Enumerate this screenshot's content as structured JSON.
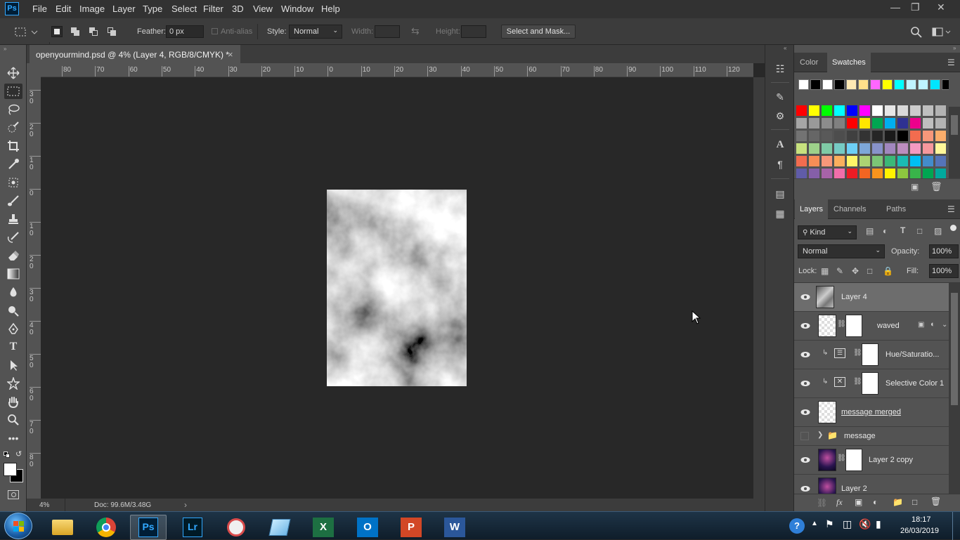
{
  "app": {
    "logo": "Ps"
  },
  "menu": [
    "File",
    "Edit",
    "Image",
    "Layer",
    "Type",
    "Select",
    "Filter",
    "3D",
    "View",
    "Window",
    "Help"
  ],
  "options": {
    "feather_label": "Feather:",
    "feather_value": "0 px",
    "antialias_label": "Anti-alias",
    "style_label": "Style:",
    "style_value": "Normal",
    "width_label": "Width:",
    "height_label": "Height:",
    "select_mask": "Select and Mask..."
  },
  "document": {
    "tab_title": "openyourmind.psd @ 4% (Layer 4, RGB/8/CMYK) *",
    "close": "×",
    "zoom": "4%",
    "doc_size": "Doc: 99.6M/3.48G"
  },
  "ruler": {
    "h_labels": [
      "80",
      "70",
      "60",
      "50",
      "40",
      "30",
      "20",
      "10",
      "0",
      "10",
      "20",
      "30",
      "40",
      "50",
      "60",
      "70",
      "80",
      "90",
      "100",
      "110",
      "120"
    ],
    "v_labels": [
      "3 0",
      "2 0",
      "1 0",
      "0",
      "1 0",
      "2 0",
      "3 0",
      "4 0",
      "5 0",
      "6 0",
      "7 0",
      "8 0"
    ]
  },
  "swatches_panel": {
    "tabs": [
      "Color",
      "Swatches"
    ],
    "active_tab": "Swatches",
    "rows": [
      [
        "#ffffff",
        "#000000",
        "#ffffff",
        "#000000",
        "#fde9b4",
        "#ffe08a",
        "#ff66ff",
        "#ffff00",
        "#00ffff",
        "#bff4ff",
        "#bff4ff",
        "#00e5ff",
        "#000000"
      ],
      [
        "#ff0000",
        "#ffff00",
        "#00ff00",
        "#00ffff",
        "#0000ff",
        "#ff00ff",
        "#ffffff",
        "#e6e6e6",
        "#d9d9d9",
        "#cccccc",
        "#bfbfbf",
        "#b3b3b3"
      ],
      [
        "#a6a6a6",
        "#999999",
        "#8c8c8c",
        "#808080",
        "#ff0000",
        "#ffe600",
        "#00a651",
        "#00aeef",
        "#2e3192",
        "#ec008c",
        "#bfbfbf",
        "#b3b3b3"
      ],
      [
        "#737373",
        "#666666",
        "#595959",
        "#4d4d4d",
        "#404040",
        "#333333",
        "#262626",
        "#1a1a1a",
        "#000000",
        "#f26c4f",
        "#f7977a",
        "#fbad6b"
      ],
      [
        "#c7e17e",
        "#9dd18a",
        "#7fcaa6",
        "#76cbc4",
        "#6dcff6",
        "#7da7d8",
        "#8893ca",
        "#a187be",
        "#bc8dbf",
        "#f49ac1",
        "#f6989d",
        "#fff79a"
      ],
      [
        "#f26c4f",
        "#f68e56",
        "#f7977a",
        "#fbaf5d",
        "#fff568",
        "#acd373",
        "#7cc576",
        "#3bb878",
        "#1abbb4",
        "#00bff3",
        "#438ccb",
        "#5574b9"
      ],
      [
        "#605ca8",
        "#855fa8",
        "#a763a8",
        "#f06eaa",
        "#ed1c24",
        "#f26522",
        "#f7941d",
        "#fff200",
        "#8dc63f",
        "#39b54a",
        "#00a651",
        "#00a99d"
      ]
    ]
  },
  "layers_panel": {
    "tabs": [
      "Layers",
      "Channels",
      "Paths"
    ],
    "active_tab": "Layers",
    "kind": "Kind",
    "blend_mode": "Normal",
    "opacity_label": "Opacity:",
    "opacity_value": "100%",
    "lock_label": "Lock:",
    "fill_label": "Fill:",
    "fill_value": "100%",
    "layers": [
      {
        "name": "Layer 4",
        "visible": true,
        "selected": true
      },
      {
        "name": "waved",
        "visible": true
      },
      {
        "name": "Hue/Saturatio...",
        "visible": true
      },
      {
        "name": "Selective Color 1",
        "visible": true
      },
      {
        "name": "message merged",
        "visible": true
      },
      {
        "name": "message",
        "visible": false
      },
      {
        "name": "Layer 2 copy",
        "visible": true
      },
      {
        "name": "Layer 2",
        "visible": true
      }
    ]
  },
  "taskbar": {
    "time": "18:17",
    "date": "26/03/2019",
    "apps": [
      "windows-explorer",
      "chrome",
      "photoshop",
      "lightroom",
      "snipping-tool",
      "notepad",
      "excel",
      "outlook",
      "powerpoint",
      "word"
    ]
  }
}
